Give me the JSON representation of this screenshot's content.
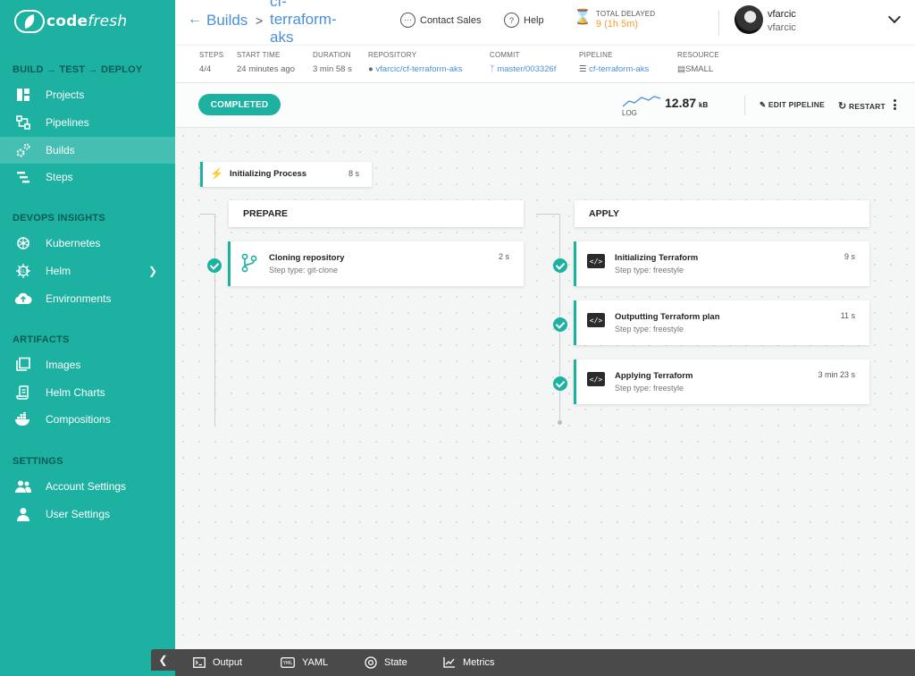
{
  "brand": {
    "logo_plain": "code",
    "logo_italic": "fresh"
  },
  "sidebar": {
    "sections": [
      {
        "title": "BUILD → TEST → DEPLOY"
      },
      {
        "title": "DEVOPS INSIGHTS"
      },
      {
        "title": "ARTIFACTS"
      },
      {
        "title": "SETTINGS"
      }
    ],
    "items": [
      {
        "label": "Projects",
        "icon": "projects-icon"
      },
      {
        "label": "Pipelines",
        "icon": "pipelines-icon"
      },
      {
        "label": "Builds",
        "icon": "builds-icon",
        "active": true
      },
      {
        "label": "Steps",
        "icon": "steps-icon"
      },
      {
        "label": "Kubernetes",
        "icon": "kubernetes-icon"
      },
      {
        "label": "Helm",
        "icon": "helm-icon"
      },
      {
        "label": "Environments",
        "icon": "environments-icon"
      },
      {
        "label": "Images",
        "icon": "images-icon"
      },
      {
        "label": "Helm Charts",
        "icon": "helm-charts-icon"
      },
      {
        "label": "Compositions",
        "icon": "compositions-icon"
      },
      {
        "label": "Account Settings",
        "icon": "account-settings-icon"
      },
      {
        "label": "User Settings",
        "icon": "user-settings-icon"
      }
    ]
  },
  "header": {
    "breadcrumb_root": "Builds",
    "breadcrumb_sep": ">",
    "build_name_lines": [
      "cf-",
      "terraform-",
      "aks"
    ],
    "contact_sales": "Contact Sales",
    "help": "Help",
    "total_delayed_label": "TOTAL DELAYED",
    "total_delayed_value": "9 (1h 5m)",
    "user_name": "vfarcic",
    "user_account": "vfarcic"
  },
  "info": {
    "steps": {
      "label": "STEPS",
      "value": "4/4"
    },
    "start_time": {
      "label": "START TIME",
      "value": "24 minutes ago"
    },
    "duration": {
      "label": "DURATION",
      "value": "3 min 58 s"
    },
    "repository": {
      "label": "REPOSITORY",
      "value": "vfarcic/cf-terraform-aks"
    },
    "commit": {
      "label": "COMMIT",
      "value": "master/003326f"
    },
    "pipeline": {
      "label": "PIPELINE",
      "value": "cf-terraform-aks"
    },
    "resource": {
      "label": "RESOURCE",
      "value": "SMALL"
    }
  },
  "actions": {
    "status": "COMPLETED",
    "log_label": "LOG",
    "log_size": "12.87",
    "log_unit": "kB",
    "edit_pipeline": "EDIT PIPELINE",
    "restart": "RESTART"
  },
  "workflow": {
    "init": {
      "title": "Initializing Process",
      "time": "8 s"
    },
    "stages": [
      {
        "name": "PREPARE",
        "steps": [
          {
            "title": "Cloning repository",
            "type": "Step type: git-clone",
            "time": "2 s",
            "icon": "git-branch-icon"
          }
        ]
      },
      {
        "name": "APPLY",
        "steps": [
          {
            "title": "Initializing Terraform",
            "type": "Step type: freestyle",
            "time": "9 s",
            "icon": "terminal-icon"
          },
          {
            "title": "Outputting Terraform plan",
            "type": "Step type: freestyle",
            "time": "11 s",
            "icon": "terminal-icon"
          },
          {
            "title": "Applying Terraform",
            "type": "Step type: freestyle",
            "time": "3 min 23 s",
            "icon": "terminal-icon"
          }
        ]
      }
    ]
  },
  "bottom_tabs": [
    {
      "label": "Output",
      "icon": "terminal-icon"
    },
    {
      "label": "YAML",
      "icon": "yaml-icon"
    },
    {
      "label": "State",
      "icon": "state-icon"
    },
    {
      "label": "Metrics",
      "icon": "metrics-icon"
    }
  ],
  "colors": {
    "brand": "#1cb1a1",
    "link": "#4a90d9",
    "warning": "#f0a030",
    "bottom_bar": "#4a4a4a"
  }
}
